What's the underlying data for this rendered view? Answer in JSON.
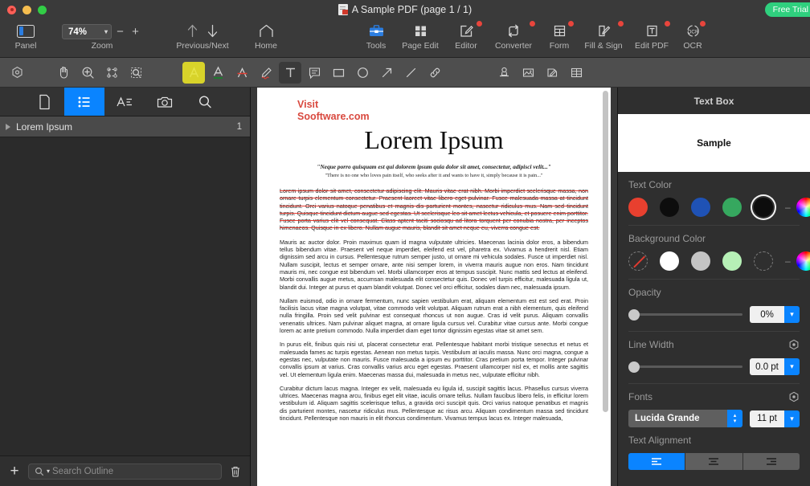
{
  "window": {
    "title": "A Sample PDF (page 1 / 1)",
    "trial_badge": "Free Trial"
  },
  "toolbar": {
    "panel": {
      "label": "Panel",
      "icon": "panel-icon"
    },
    "zoom": {
      "label": "Zoom",
      "value": "74%",
      "minus": "−",
      "plus": "+"
    },
    "prevnext": {
      "label": "Previous/Next",
      "icon": "arrow-up-down-icon"
    },
    "home": {
      "label": "Home",
      "icon": "home-icon"
    },
    "items": [
      {
        "label": "Tools",
        "icon": "toolbox-icon",
        "badge": false
      },
      {
        "label": "Page Edit",
        "icon": "grid-squares-icon",
        "badge": false
      },
      {
        "label": "Editor",
        "icon": "pencil-square-icon",
        "badge": true
      },
      {
        "label": "Converter",
        "icon": "convert-arrows-icon",
        "badge": true
      },
      {
        "label": "Form",
        "icon": "form-table-icon",
        "badge": true
      },
      {
        "label": "Fill & Sign",
        "icon": "fill-sign-icon",
        "badge": true
      },
      {
        "label": "Edit PDF",
        "icon": "text-box-icon",
        "badge": true
      },
      {
        "label": "OCR",
        "icon": "ocr-icon",
        "badge": true
      }
    ]
  },
  "annotation_bar": {
    "tools": [
      {
        "name": "settings-gear-icon",
        "state": "normal"
      },
      {
        "name": "hand-icon",
        "state": "normal"
      },
      {
        "name": "zoom-in-icon",
        "state": "normal"
      },
      {
        "name": "select-area-icon",
        "state": "normal"
      },
      {
        "name": "marquee-zoom-icon",
        "state": "normal"
      },
      {
        "name": "highlight-icon",
        "state": "highlighted"
      },
      {
        "name": "underline-icon",
        "state": "normal"
      },
      {
        "name": "strikethrough-icon",
        "state": "normal"
      },
      {
        "name": "squiggly-icon",
        "state": "normal"
      },
      {
        "name": "text-box-tool-icon",
        "state": "selected"
      },
      {
        "name": "note-icon",
        "state": "normal"
      },
      {
        "name": "rectangle-icon",
        "state": "normal"
      },
      {
        "name": "ellipse-icon",
        "state": "normal"
      },
      {
        "name": "arrow-icon",
        "state": "normal"
      },
      {
        "name": "line-icon",
        "state": "normal"
      },
      {
        "name": "link-icon",
        "state": "normal"
      },
      {
        "name": "stamp-icon",
        "state": "normal"
      },
      {
        "name": "image-icon",
        "state": "normal"
      },
      {
        "name": "signature-icon",
        "state": "normal"
      },
      {
        "name": "table-icon",
        "state": "normal"
      }
    ]
  },
  "sidebar": {
    "tabs": [
      {
        "name": "thumbnails-tab",
        "icon": "page-icon",
        "selected": false
      },
      {
        "name": "outline-tab",
        "icon": "list-icon",
        "selected": true
      },
      {
        "name": "annotations-tab",
        "icon": "text-list-icon",
        "selected": false
      },
      {
        "name": "snapshot-tab",
        "icon": "camera-icon",
        "selected": false
      },
      {
        "name": "search-tab",
        "icon": "search-icon",
        "selected": false
      }
    ],
    "outline": [
      {
        "title": "Lorem Ipsum",
        "page": "1"
      }
    ],
    "bottom": {
      "add_label": "+",
      "search_placeholder": "Search Outline"
    }
  },
  "document": {
    "visit_line1": "Visit",
    "visit_line2": "Sooftware.com",
    "title": "Lorem Ipsum",
    "quote_latin": "\"Neque porro quisquam est qui dolorem ipsum quia dolor sit amet, consectetur, adipisci velit...\"",
    "quote_english": "\"There is no one who loves pain itself, who seeks after it and wants to have it, simply because it is pain...\"",
    "paragraphs": [
      {
        "struck": true,
        "text": "Lorem ipsum dolor sit amet, consectetur adipiscing elit. Mauris vitae erat nibh. Morbi imperdiet scelerisque massa, non ornare turpis elementum consectetur. Praesent laoreet vitae libero eget pulvinar. Fusce malesuada massa at tincidunt tincidunt. Orci varius natoque penatibus et magnis dis parturient montes, nascetur ridiculus mus. Nam sed tincidunt turpis. Quisque tincidunt dictum augue sed egestas. Ut scelerisque leo sit amet lectus vehicula, et posuere enim porttitor. Fusce porta varius elit vel consequat. Class aptent taciti sociosqu ad litora torquent per conubia nostra, per inceptos himenaeos. Quisque in ex libero. Nullam augue mauris, blandit sit amet neque eu, viverra congue est."
      },
      {
        "struck": false,
        "text": "Mauris ac auctor dolor. Proin maximus quam id magna vulputate ultricies. Maecenas lacinia dolor eros, a bibendum tellus bibendum vitae. Praesent vel neque imperdiet, eleifend est vel, pharetra ex. Vivamus a hendrerit nisl. Etiam dignissim sed arcu in cursus. Pellentesque rutrum semper justo, ut ornare mi vehicula sodales. Fusce ut imperdiet nisl. Nullam suscipit, lectus et semper ornare, ante nisi semper lorem, in viverra mauris augue non eros. Nam tincidunt mauris mi, nec congue est bibendum vel. Morbi ullamcorper eros at tempus suscipit. Nunc mattis sed lectus at eleifend. Morbi convallis augue metus, accumsan malesuada elit consectetur quis. Donec vel turpis efficitur, malesuada ligula ut, blandit dui. Integer at purus et quam blandit volutpat. Donec vel orci efficitur, sodales diam nec, malesuada ipsum."
      },
      {
        "struck": false,
        "text": "Nullam euismod, odio in ornare fermentum, nunc sapien vestibulum erat, aliquam elementum est est sed erat. Proin facilisis lacus vitae magna volutpat, vitae commodo velit volutpat. Aliquam rutrum erat a nibh elementum, quis eleifend nulla fringilla. Proin sed velit pulvinar est consequat rhoncus ut non augue. Cras id velit purus. Aliquam convallis venenatis ultrices. Nam pulvinar aliquet magna, at ornare ligula cursus vel. Curabitur vitae cursus ante. Morbi congue lorem ac ante pretium commodo. Nulla imperdiet diam eget tortor dignissim egestas vitae sit amet sem."
      },
      {
        "struck": false,
        "text": "In purus elit, finibus quis nisi ut, placerat consectetur erat. Pellentesque habitant morbi tristique senectus et netus et malesuada fames ac turpis egestas. Aenean non metus turpis. Vestibulum at iaculis massa. Nunc orci magna, congue a egestas nec, vulputate non mauris. Fusce malesuada a ipsum eu porttitor. Cras pretium porta tempor. Integer pulvinar convallis ipsum at varius. Cras convallis varius arcu eget egestas. Praesent ullamcorper nisl ex, et mollis ante sagittis vel. Ut elementum ligula enim. Maecenas massa dui, malesuada in metus nec, vulputate efficitur nibh."
      },
      {
        "struck": false,
        "text": "Curabitur dictum lacus magna. Integer ex velit, malesuada eu ligula id, suscipit sagittis lacus. Phasellus cursus viverra ultrices. Maecenas magna arcu, finibus eget elit vitae, iaculis ornare tellus. Nullam faucibus libero felis, in efficitur lorem vestibulum id. Aliquam sagittis scelerisque tellus, a gravida orci suscipit quis. Orci varius natoque penatibus et magnis dis parturient montes, nascetur ridiculus mus. Pellentesque ac risus arcu. Aliquam condimentum massa sed tincidunt tincidunt. Pellentesque non mauris in elit rhoncus condimentum. Vivamus tempus lacus ex. Integer malesuada,"
      }
    ]
  },
  "inspector": {
    "title": "Text Box",
    "preview_text": "Sample",
    "text_color": {
      "label": "Text Color",
      "swatches": [
        "#e8402f",
        "#0d0d0d",
        "#1f52b5",
        "#36a85f",
        "#0d0d0d",
        "color-wheel"
      ],
      "selected_index": 4
    },
    "background_color": {
      "label": "Background Color",
      "swatches": [
        "none",
        "#ffffff",
        "#c4c4c4",
        "#b6f0b6",
        "empty",
        "color-wheel"
      ],
      "selected_index": -1
    },
    "opacity": {
      "label": "Opacity",
      "value": "0%"
    },
    "line_width": {
      "label": "Line Width",
      "value": "0.0 pt"
    },
    "fonts": {
      "label": "Fonts",
      "family": "Lucida Grande",
      "size": "11 pt"
    },
    "text_alignment": {
      "label": "Text Alignment",
      "options": [
        "align-left",
        "align-center",
        "align-right"
      ],
      "selected_index": 0
    }
  }
}
